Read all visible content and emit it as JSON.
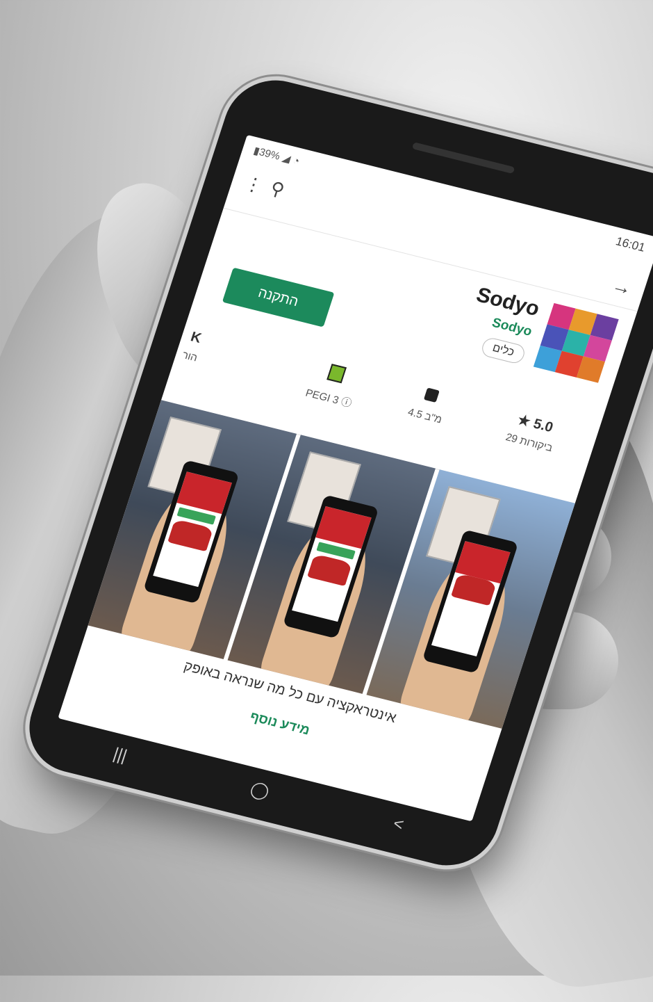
{
  "status": {
    "battery": "39%",
    "time": "16:01"
  },
  "toolbar": {
    "menu": "menu-icon",
    "search": "search-icon",
    "back": "arrow-right-icon"
  },
  "app": {
    "title": "Sodyo",
    "developer": "Sodyo",
    "category": "כלים",
    "install_label": "התקנה",
    "icon_colors": [
      "#d6357e",
      "#e89a2c",
      "#6b3fa0",
      "#4a53b8",
      "#2bb2a8",
      "#d3469c",
      "#3da0d9",
      "#e0412f",
      "#e07b2a"
    ]
  },
  "stats": {
    "rating": "★ 5.0",
    "reviews": "29 ביקורות",
    "size": "4.5 מ\"ב",
    "pegi": "PEGI 3 ⓘ",
    "partial_top": "K",
    "partial_bottom": "הור"
  },
  "description": "אינטראקציה עם כל מה שנראה באופק",
  "more_info": "מידע נוסף",
  "nav": {
    "recent": "|||",
    "home": "◯",
    "back": "<"
  }
}
